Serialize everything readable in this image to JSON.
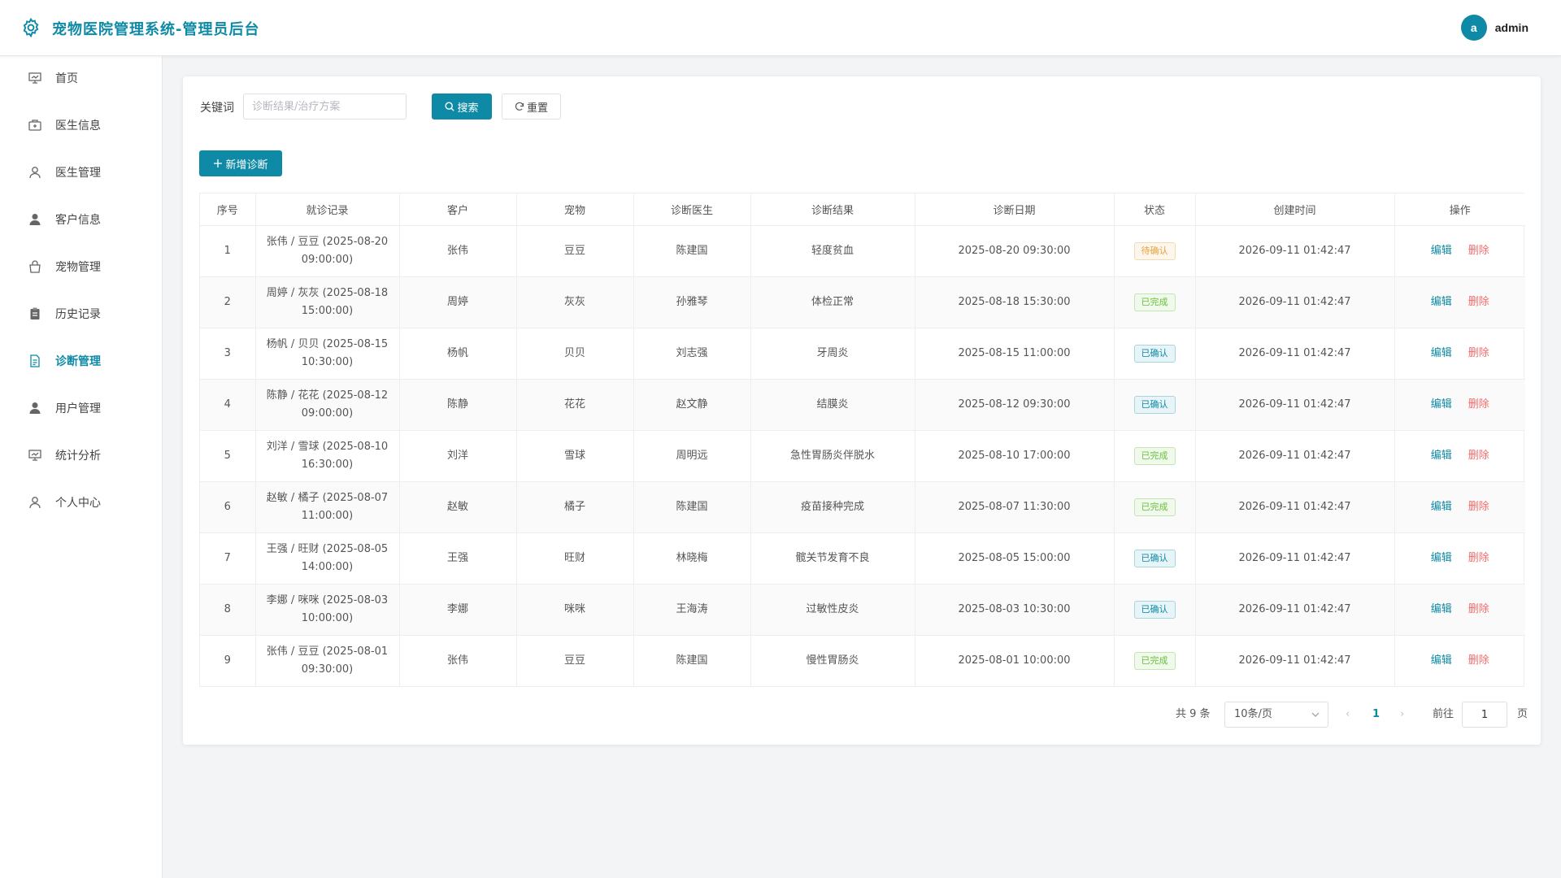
{
  "header": {
    "title": "宠物医院管理系统-管理员后台",
    "avatar_letter": "a",
    "username": "admin",
    "logo_icon": "gear-icon"
  },
  "sidebar": {
    "items": [
      {
        "label": "首页",
        "icon": "presentation-icon"
      },
      {
        "label": "医生信息",
        "icon": "medical-box-icon"
      },
      {
        "label": "医生管理",
        "icon": "user-outline-icon"
      },
      {
        "label": "客户信息",
        "icon": "user-filled-icon"
      },
      {
        "label": "宠物管理",
        "icon": "bag-icon"
      },
      {
        "label": "历史记录",
        "icon": "clipboard-icon"
      },
      {
        "label": "诊断管理",
        "icon": "document-icon",
        "active": true
      },
      {
        "label": "用户管理",
        "icon": "user-filled-icon"
      },
      {
        "label": "统计分析",
        "icon": "presentation-icon"
      },
      {
        "label": "个人中心",
        "icon": "user-outline-icon"
      }
    ]
  },
  "search": {
    "label": "关键词",
    "value": "",
    "placeholder": "诊断结果/治疗方案",
    "search_label": "搜索",
    "reset_label": "重置"
  },
  "toolbar": {
    "add_label": "新增诊断"
  },
  "table": {
    "columns": [
      "序号",
      "就诊记录",
      "客户",
      "宠物",
      "诊断医生",
      "诊断结果",
      "诊断日期",
      "状态",
      "创建时间",
      "操作"
    ],
    "rows": [
      {
        "no": "1",
        "record_line1": "张伟 / 豆豆 (2025-08-20",
        "record_line2": "09:00:00)",
        "customer": "张伟",
        "pet": "豆豆",
        "doctor": "陈建国",
        "result": "轻度贫血",
        "date": "2025-08-20 09:30:00",
        "status": "待确认",
        "status_type": "warn",
        "created": "2026-09-11 01:42:47"
      },
      {
        "no": "2",
        "record_line1": "周婷 / 灰灰 (2025-08-18",
        "record_line2": "15:00:00)",
        "customer": "周婷",
        "pet": "灰灰",
        "doctor": "孙雅琴",
        "result": "体检正常",
        "date": "2025-08-18 15:30:00",
        "status": "已完成",
        "status_type": "ok",
        "created": "2026-09-11 01:42:47"
      },
      {
        "no": "3",
        "record_line1": "杨帆 / 贝贝 (2025-08-15",
        "record_line2": "10:30:00)",
        "customer": "杨帆",
        "pet": "贝贝",
        "doctor": "刘志强",
        "result": "牙周炎",
        "date": "2025-08-15 11:00:00",
        "status": "已确认",
        "status_type": "info",
        "created": "2026-09-11 01:42:47"
      },
      {
        "no": "4",
        "record_line1": "陈静 / 花花 (2025-08-12",
        "record_line2": "09:00:00)",
        "customer": "陈静",
        "pet": "花花",
        "doctor": "赵文静",
        "result": "结膜炎",
        "date": "2025-08-12 09:30:00",
        "status": "已确认",
        "status_type": "info",
        "created": "2026-09-11 01:42:47"
      },
      {
        "no": "5",
        "record_line1": "刘洋 / 雪球 (2025-08-10",
        "record_line2": "16:30:00)",
        "customer": "刘洋",
        "pet": "雪球",
        "doctor": "周明远",
        "result": "急性胃肠炎伴脱水",
        "date": "2025-08-10 17:00:00",
        "status": "已完成",
        "status_type": "ok",
        "created": "2026-09-11 01:42:47"
      },
      {
        "no": "6",
        "record_line1": "赵敏 / 橘子 (2025-08-07",
        "record_line2": "11:00:00)",
        "customer": "赵敏",
        "pet": "橘子",
        "doctor": "陈建国",
        "result": "疫苗接种完成",
        "date": "2025-08-07 11:30:00",
        "status": "已完成",
        "status_type": "ok",
        "created": "2026-09-11 01:42:47"
      },
      {
        "no": "7",
        "record_line1": "王强 / 旺财 (2025-08-05",
        "record_line2": "14:00:00)",
        "customer": "王强",
        "pet": "旺财",
        "doctor": "林晓梅",
        "result": "髋关节发育不良",
        "date": "2025-08-05 15:00:00",
        "status": "已确认",
        "status_type": "info",
        "created": "2026-09-11 01:42:47"
      },
      {
        "no": "8",
        "record_line1": "李娜 / 咪咪 (2025-08-03",
        "record_line2": "10:00:00)",
        "customer": "李娜",
        "pet": "咪咪",
        "doctor": "王海涛",
        "result": "过敏性皮炎",
        "date": "2025-08-03 10:30:00",
        "status": "已确认",
        "status_type": "info",
        "created": "2026-09-11 01:42:47"
      },
      {
        "no": "9",
        "record_line1": "张伟 / 豆豆 (2025-08-01",
        "record_line2": "09:30:00)",
        "customer": "张伟",
        "pet": "豆豆",
        "doctor": "陈建国",
        "result": "慢性胃肠炎",
        "date": "2025-08-01 10:00:00",
        "status": "已完成",
        "status_type": "ok",
        "created": "2026-09-11 01:42:47"
      }
    ],
    "edit_label": "编辑",
    "delete_label": "删除"
  },
  "pagination": {
    "total_text": "共 9 条",
    "page_size": "10条/页",
    "current_page": "1",
    "prev_symbol": "‹",
    "next_symbol": "›",
    "goto_label": "前往",
    "goto_value": "1",
    "goto_unit": "页"
  },
  "colors": {
    "accent": "#0e8aa6",
    "danger": "#f56c6c",
    "warning": "#e6a23c",
    "success": "#67c23a"
  }
}
